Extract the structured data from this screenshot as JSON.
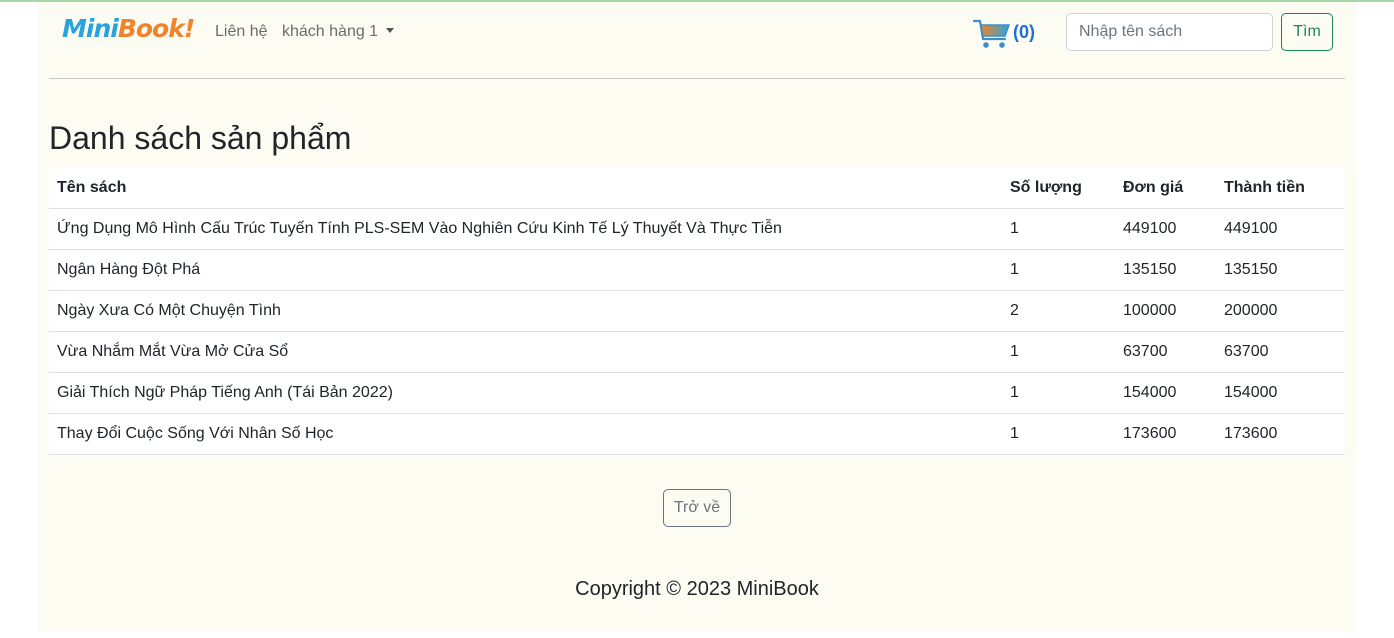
{
  "brand": {
    "part1": "Mini",
    "part2": "Book!"
  },
  "nav": {
    "contact": "Liên hệ",
    "customer": "khách hàng 1"
  },
  "cart": {
    "count": "(0)",
    "icon": "shopping-cart-icon"
  },
  "search": {
    "placeholder": "Nhập tên sách",
    "button": "Tìm"
  },
  "page_title": "Danh sách sản phẩm",
  "table": {
    "headers": [
      "Tên sách",
      "Số lượng",
      "Đơn giá",
      "Thành tiền"
    ],
    "rows": [
      [
        "Ứng Dụng Mô Hình Cấu Trúc Tuyến Tính PLS-SEM Vào Nghiên Cứu Kinh Tế Lý Thuyết Và Thực Tiễn",
        "1",
        "449100",
        "449100"
      ],
      [
        "Ngân Hàng Đột Phá",
        "1",
        "135150",
        "135150"
      ],
      [
        "Ngày Xưa Có Một Chuyện Tình",
        "2",
        "100000",
        "200000"
      ],
      [
        "Vừa Nhắm Mắt Vừa Mở Cửa Sổ",
        "1",
        "63700",
        "63700"
      ],
      [
        "Giải Thích Ngữ Pháp Tiếng Anh (Tái Bản 2022)",
        "1",
        "154000",
        "154000"
      ],
      [
        "Thay Đổi Cuộc Sống Với Nhân Số Học",
        "1",
        "173600",
        "173600"
      ]
    ]
  },
  "back_button": "Trở về",
  "footer": {
    "copyright": "Copyright © 2023 MiniBook"
  },
  "colors": {
    "background": "#fdfcf3",
    "accent_green": "#198754",
    "cart_blue": "#1f6fd6"
  }
}
